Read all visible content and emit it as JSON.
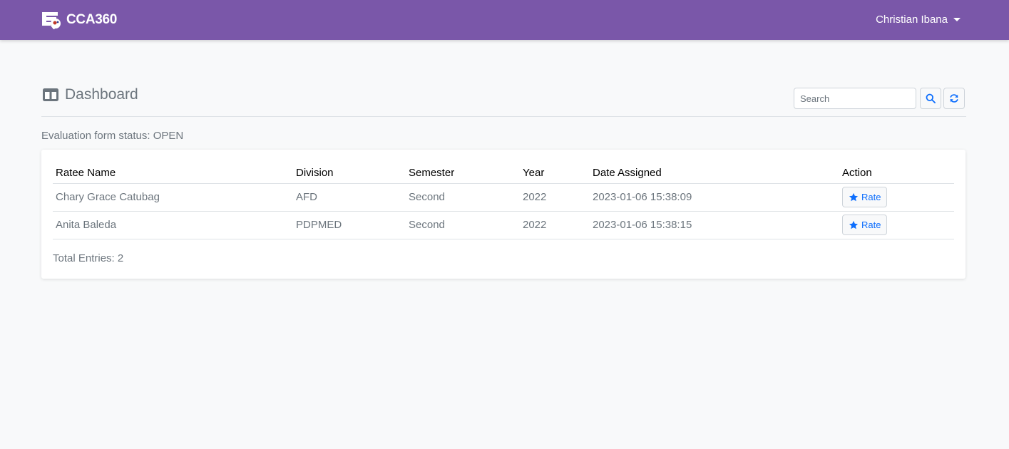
{
  "navbar": {
    "brand": "CCA360",
    "user_name": "Christian Ibana",
    "colors": {
      "navbar": "#7a57a9",
      "accent": "#0d6efd"
    }
  },
  "header": {
    "title": "Dashboard",
    "title_icon": "columns-icon",
    "search_placeholder": "Search",
    "search_icon": "search-icon",
    "refresh_icon": "refresh-icon"
  },
  "status": "Evaluation form status: OPEN",
  "table": {
    "columns": [
      "Ratee Name",
      "Division",
      "Semester",
      "Year",
      "Date Assigned",
      "Action"
    ],
    "rows": [
      {
        "name": "Chary Grace Catubag",
        "division": "AFD",
        "semester": "Second",
        "year": "2022",
        "date": "2023-01-06 15:38:09",
        "action": "Rate"
      },
      {
        "name": "Anita Baleda",
        "division": "PDPMED",
        "semester": "Second",
        "year": "2022",
        "date": "2023-01-06 15:38:15",
        "action": "Rate"
      }
    ]
  },
  "footer": {
    "total": "Total Entries: 2"
  }
}
